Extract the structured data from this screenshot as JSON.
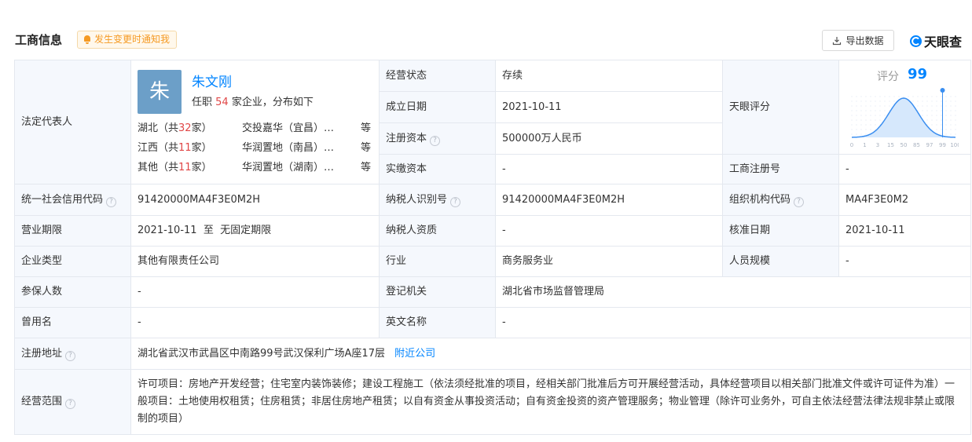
{
  "header": {
    "title": "工商信息",
    "notify_label": "发生变更时通知我",
    "export_label": "导出数据",
    "brand": "天眼查"
  },
  "legal_rep": {
    "label": "法定代表人",
    "avatar_char": "朱",
    "name": "朱文刚",
    "sub_prefix": "任职",
    "sub_count": "54",
    "sub_suffix": "家企业，分布如下",
    "regions": [
      {
        "prov_prefix": "湖北（共",
        "count": "32",
        "prov_suffix": "家）",
        "company": "交投嘉华（宜昌）城市发展有限公司",
        "etc": "等"
      },
      {
        "prov_prefix": "江西（共",
        "count": "11",
        "prov_suffix": "家）",
        "company": "华润置地（南昌）实业有限公司",
        "etc": "等"
      },
      {
        "prov_prefix": "其他（共",
        "count": "11",
        "prov_suffix": "家）",
        "company": "华润置地（湖南）有限公司",
        "etc": "等"
      }
    ]
  },
  "fields": {
    "status_label": "经营状态",
    "status": "存续",
    "found_label": "成立日期",
    "found": "2021-10-11",
    "capital_label": "注册资本",
    "capital": "500000万人民币",
    "paid_label": "实缴资本",
    "paid": "-",
    "score_label": "天眼评分",
    "regno_label": "工商注册号",
    "regno": "-",
    "credit_label": "统一社会信用代码",
    "credit": "91420000MA4F3E0M2H",
    "taxid_label": "纳税人识别号",
    "taxid": "91420000MA4F3E0M2H",
    "org_label": "组织机构代码",
    "org": "MA4F3E0M2",
    "term_label": "营业期限",
    "term": "2021-10-11  至  无固定期限",
    "taxq_label": "纳税人资质",
    "taxq": "-",
    "approve_label": "核准日期",
    "approve": "2021-10-11",
    "type_label": "企业类型",
    "type": "其他有限责任公司",
    "industry_label": "行业",
    "industry": "商务服务业",
    "staff_label": "人员规模",
    "staff": "-",
    "insured_label": "参保人数",
    "insured": "-",
    "authority_label": "登记机关",
    "authority": "湖北省市场监督管理局",
    "former_label": "曾用名",
    "former": "-",
    "en_label": "英文名称",
    "en": "-",
    "addr_label": "注册地址",
    "addr": "湖北省武汉市武昌区中南路99号武汉保利广场A座17层",
    "nearby_label": "附近公司",
    "scope_label": "经营范围",
    "scope": "许可项目：房地产开发经营；住宅室内装饰装修；建设工程施工（依法须经批准的项目，经相关部门批准后方可开展经营活动，具体经营项目以相关部门批准文件或许可证件为准）一般项目：土地使用权租赁；住房租赁；非居住房地产租赁；以自有资金从事投资活动；自有资金投资的资产管理服务；物业管理（除许可业务外，可自主依法经营法律法规非禁止或限制的项目）"
  },
  "score": {
    "title": "评分",
    "value": "99",
    "value_num": 99,
    "ticks": [
      "0",
      "1",
      "3",
      "15",
      "50",
      "85",
      "97",
      "99",
      "100"
    ],
    "colors": {
      "curve": "#3a8ef0",
      "fill": "#d6e8fc",
      "marker": "#3a8ef0"
    }
  },
  "colors": {
    "accent": "#0084ff",
    "highlight": "#e04646",
    "notify": "#f59a23",
    "label_bg": "#f5f8fd"
  }
}
